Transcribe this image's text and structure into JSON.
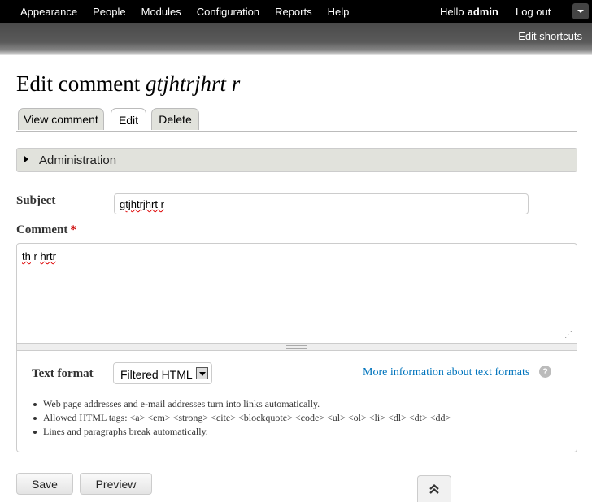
{
  "toolbar": {
    "menu": [
      "Appearance",
      "People",
      "Modules",
      "Configuration",
      "Reports",
      "Help"
    ],
    "hello_prefix": "Hello",
    "username": "admin",
    "logout": "Log out"
  },
  "shortcuts": {
    "edit_label": "Edit shortcuts"
  },
  "page": {
    "title_prefix": "Edit comment",
    "title_subject": "gtjhtrjhrt r"
  },
  "tabs": [
    {
      "label": "View comment",
      "active": false
    },
    {
      "label": "Edit",
      "active": true
    },
    {
      "label": "Delete",
      "active": false
    }
  ],
  "admin_fieldset": {
    "label": "Administration"
  },
  "form": {
    "subject_label": "Subject",
    "subject_value": "gtjhtrjhrt r",
    "comment_label": "Comment",
    "comment_required_mark": "*",
    "comment_value_word1": "th",
    "comment_value_word2": "r",
    "comment_value_word3": "hrtr"
  },
  "text_format": {
    "label": "Text format",
    "selected": "Filtered HTML",
    "more_info": "More information about text formats",
    "help_glyph": "?",
    "tips": [
      "Web page addresses and e-mail addresses turn into links automatically.",
      "Allowed HTML tags: <a> <em> <strong> <cite> <blockquote> <code> <ul> <ol> <li> <dl> <dt> <dd>",
      "Lines and paragraphs break automatically."
    ]
  },
  "actions": {
    "save": "Save",
    "preview": "Preview"
  },
  "colors": {
    "link": "#0074bd",
    "required": "#cc0000",
    "toolbar": "#000000"
  }
}
